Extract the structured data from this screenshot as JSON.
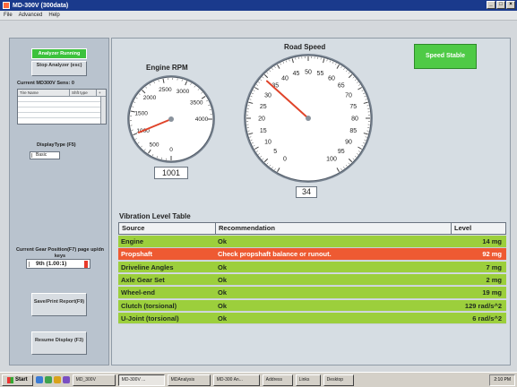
{
  "window": {
    "title": "MD-300V (300data)",
    "buttons": [
      "_",
      "□",
      "×"
    ]
  },
  "menu": [
    "File",
    "Advanced",
    "Help"
  ],
  "left_panel": {
    "analyzer_running": "Analyzer Running",
    "stop_analyzer": "Stop Analyzer (esc)",
    "current_sensors": "Current MD300V Sens: 0",
    "sensor_columns": [
      "Tire Name",
      "Shft type",
      "+"
    ],
    "display_type_label": "DisplayType (F5)",
    "display_type_value": "Basic",
    "gear_label": "Current Gear Position(F7) page up/dn keys",
    "gear_value": "9th (1.00:1)",
    "save_print": "Save/Print Report(F9)",
    "resume_display": "Resume Display (F3)"
  },
  "gauges": {
    "engine_rpm": {
      "title": "Engine RPM",
      "value": "1001",
      "reading": 1001,
      "ticks": [
        "0",
        "500",
        "1000",
        "1500",
        "2000",
        "2500",
        "3000",
        "3500",
        "4000"
      ]
    },
    "road_speed": {
      "title": "Road Speed",
      "value": "34",
      "reading": 34,
      "ticks": [
        "0",
        "5",
        "10",
        "15",
        "20",
        "25",
        "30",
        "35",
        "40",
        "45",
        "50",
        "55",
        "60",
        "65",
        "70",
        "75",
        "80",
        "85",
        "90",
        "95",
        "100"
      ]
    }
  },
  "status": {
    "speed_stable": "Speed Stable",
    "color": "#4fca46"
  },
  "vibration": {
    "title": "Vibration Level Table",
    "headers": [
      "Source",
      "Recommendation",
      "Level"
    ],
    "rows": [
      {
        "source": "Engine",
        "recommendation": "Ok",
        "level": "14  mg",
        "status": "ok"
      },
      {
        "source": "Propshaft",
        "recommendation": "Check propshaft balance or runout.",
        "level": "92  mg",
        "status": "bad"
      },
      {
        "source": "Driveline Angles",
        "recommendation": "Ok",
        "level": "7  mg",
        "status": "ok"
      },
      {
        "source": "Axle Gear Set",
        "recommendation": "Ok",
        "level": "2  mg",
        "status": "ok"
      },
      {
        "source": "Wheel-end",
        "recommendation": "Ok",
        "level": "19  mg",
        "status": "ok"
      },
      {
        "source": "Clutch (torsional)",
        "recommendation": "Ok",
        "level": "129 rad/s^2",
        "status": "ok"
      },
      {
        "source": "U-Joint (torsional)",
        "recommendation": "Ok",
        "level": "6 rad/s^2",
        "status": "ok"
      }
    ],
    "colors": {
      "ok": "#9ccf3c",
      "bad": "#ee5a32"
    }
  },
  "taskbar": {
    "start": "Start",
    "tasks": [
      "MD_300V",
      "MD-300V ...",
      "MDAnalysis",
      "MD-300 An..."
    ],
    "address": "Address",
    "links": "Links",
    "desktop": "Desktop",
    "clock": "2:10 PM"
  }
}
